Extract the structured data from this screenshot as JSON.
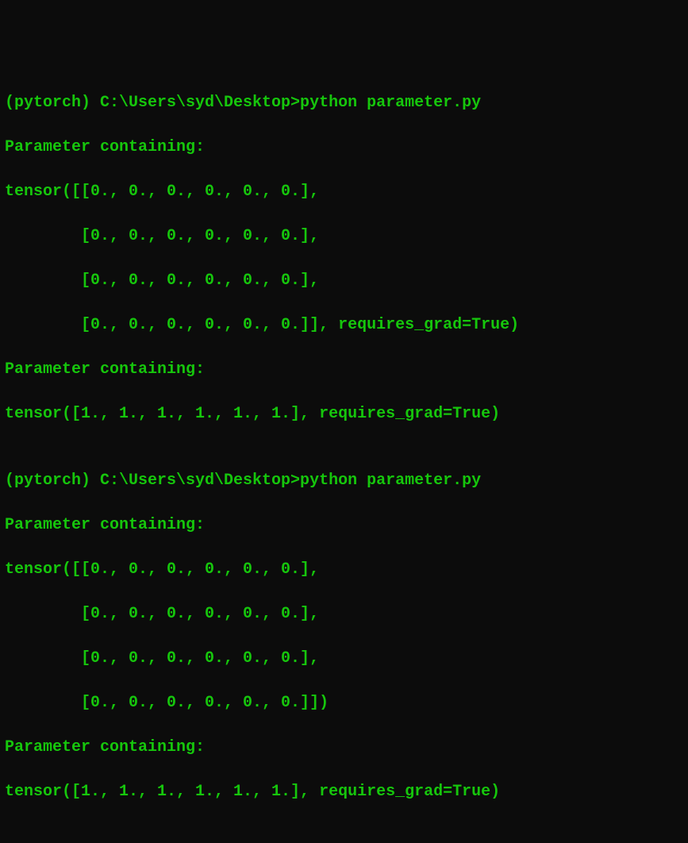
{
  "lines": {
    "l01": "(pytorch) C:\\Users\\syd\\Desktop>python parameter.py",
    "l02": "Parameter containing:",
    "l03": "tensor([[0., 0., 0., 0., 0., 0.],",
    "l04": "        [0., 0., 0., 0., 0., 0.],",
    "l05": "        [0., 0., 0., 0., 0., 0.],",
    "l06": "        [0., 0., 0., 0., 0., 0.]], requires_grad=True)",
    "l07": "Parameter containing:",
    "l08": "tensor([1., 1., 1., 1., 1., 1.], requires_grad=True)",
    "l09": "",
    "l10": "(pytorch) C:\\Users\\syd\\Desktop>python parameter.py",
    "l11": "Parameter containing:",
    "l12": "tensor([[0., 0., 0., 0., 0., 0.],",
    "l13": "        [0., 0., 0., 0., 0., 0.],",
    "l14": "        [0., 0., 0., 0., 0., 0.],",
    "l15": "        [0., 0., 0., 0., 0., 0.]])",
    "l16": "Parameter containing:",
    "l17": "tensor([1., 1., 1., 1., 1., 1.], requires_grad=True)"
  }
}
